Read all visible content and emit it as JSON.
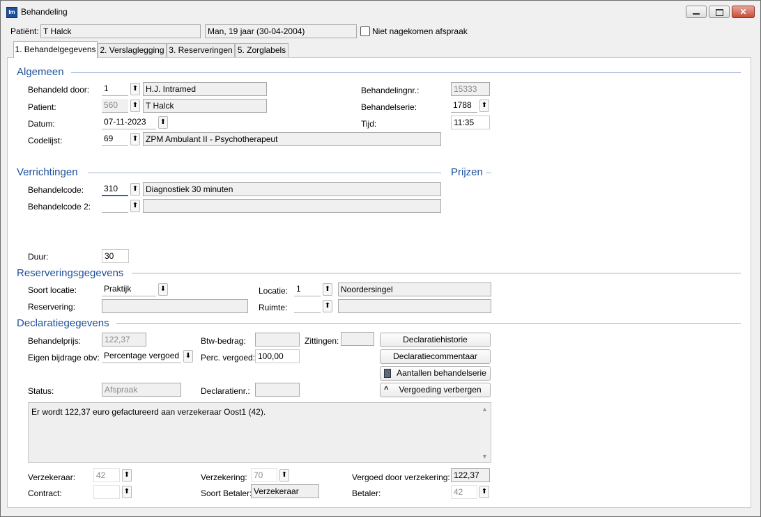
{
  "window": {
    "title": "Behandeling"
  },
  "header": {
    "patient_label": "Patiënt:",
    "patient_name": "T Halck",
    "patient_info": "Man, 19 jaar (30-04-2004)",
    "missed_label": "Niet nagekomen afspraak"
  },
  "tabs": [
    {
      "label": "1. Behandelgegevens"
    },
    {
      "label": "2. Verslaglegging"
    },
    {
      "label": "3. Reserveringen"
    },
    {
      "label": "5. Zorglabels"
    }
  ],
  "algemeen": {
    "title": "Algemeen",
    "behandeld_door_label": "Behandeld door:",
    "behandeld_door_code": "1",
    "behandeld_door_name": "H.J. Intramed",
    "patient_label": "Patient:",
    "patient_code": "560",
    "patient_name": "T Halck",
    "datum_label": "Datum:",
    "datum_value": "07-11-2023",
    "codelijst_label": "Codelijst:",
    "codelijst_code": "69",
    "codelijst_name": "ZPM Ambulant II - Psychotherapeut",
    "behandelingnr_label": "Behandelingnr.:",
    "behandelingnr_value": "15333",
    "behandelserie_label": "Behandelserie:",
    "behandelserie_value": "1788",
    "tijd_label": "Tijd:",
    "tijd_value": "11:35"
  },
  "verrichtingen": {
    "title": "Verrichtingen",
    "prijzen_title": "Prijzen",
    "behandelcode_label": "Behandelcode:",
    "behandelcode_value": "310",
    "behandelcode_desc": "Diagnostiek 30 minuten",
    "behandelcode2_label": "Behandelcode 2:",
    "behandelcode2_value": "",
    "behandelcode2_desc": "",
    "duur_label": "Duur:",
    "duur_value": "30"
  },
  "reservering": {
    "title": "Reserveringsgegevens",
    "soort_locatie_label": "Soort locatie:",
    "soort_locatie_value": "Praktijk",
    "reservering_label": "Reservering:",
    "reservering_value": "",
    "locatie_label": "Locatie:",
    "locatie_code": "1",
    "locatie_name": "Noordersingel",
    "ruimte_label": "Ruimte:",
    "ruimte_code": "",
    "ruimte_name": ""
  },
  "declaratie": {
    "title": "Declaratiegegevens",
    "behandelprijs_label": "Behandelprijs:",
    "behandelprijs_value": "122,37",
    "btw_label": "Btw-bedrag:",
    "btw_value": "",
    "zittingen_label": "Zittingen:",
    "zittingen_value": "",
    "eigen_bijdrage_label": "Eigen bijdrage obv:",
    "eigen_bijdrage_value": "Percentage vergoed",
    "perc_label": "Perc. vergoed:",
    "perc_value": "100,00",
    "status_label": "Status:",
    "status_value": "Afspraak",
    "declaratienr_label": "Declaratienr.:",
    "declaratienr_value": "",
    "btn_historie": "Declaratiehistorie",
    "btn_commentaar": "Declaratiecommentaar",
    "btn_aantallen": "Aantallen behandelserie",
    "btn_vergoeding": "Vergoeding verbergen",
    "message": "Er wordt 122,37 euro gefactureerd aan verzekeraar Oost1 (42).",
    "verzekeraar_label": "Verzekeraar:",
    "verzekeraar_value": "42",
    "contract_label": "Contract:",
    "contract_value": "",
    "verzekering_label": "Verzekering:",
    "verzekering_value": "70",
    "soort_betaler_label": "Soort Betaler:",
    "soort_betaler_value": "Verzekeraar",
    "vergoed_label": "Vergoed door verzekering:",
    "vergoed_value": "122,37",
    "betaler_label": "Betaler:",
    "betaler_value": "42"
  }
}
